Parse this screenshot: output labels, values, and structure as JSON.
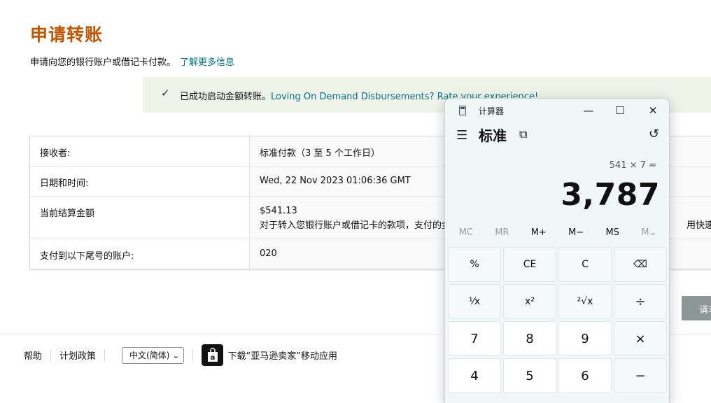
{
  "page": {
    "title": "申请转账",
    "subtitle": "申请向您的银行账户或借记卡付款。",
    "learn_more": "了解更多信息"
  },
  "success": {
    "text": "已成功启动金额转账。",
    "rate_link": "Loving On Demand Disbursements? Rate your experience!"
  },
  "table": {
    "rows": [
      {
        "label": "接收者:",
        "value": "标准付款（3 至 5 个工作日）"
      },
      {
        "label": "日期和时间:",
        "value": "Wed, 22 Nov 2023 01:06:36 GMT"
      },
      {
        "label": "当前结算金额",
        "value": "$541.13",
        "value2": "对于转入您银行账户或借记卡的款项，支付的金",
        "value2_tail": "用快速付款"
      },
      {
        "label": "支付到以下尾号的账户:",
        "value": "020"
      }
    ]
  },
  "request_button": "请求",
  "footer": {
    "help": "帮助",
    "plan_policy": "计划政策",
    "language": "中文(简体)",
    "app_download": "下载“亚马逊卖家”移动应用"
  },
  "calculator": {
    "window_title": "计算器",
    "mode": "标准",
    "expression": "541 × 7 =",
    "result": "3,787",
    "memory_keys": [
      {
        "label": "MC",
        "enabled": false
      },
      {
        "label": "MR",
        "enabled": false
      },
      {
        "label": "M+",
        "enabled": true
      },
      {
        "label": "M−",
        "enabled": true
      },
      {
        "label": "MS",
        "enabled": true
      },
      {
        "label": "M⌄",
        "enabled": false
      }
    ],
    "keys": [
      "%",
      "CE",
      "C",
      "⌫",
      "¹⁄x",
      "x²",
      "²√x",
      "÷",
      "7",
      "8",
      "9",
      "×",
      "4",
      "5",
      "6",
      "−"
    ]
  }
}
